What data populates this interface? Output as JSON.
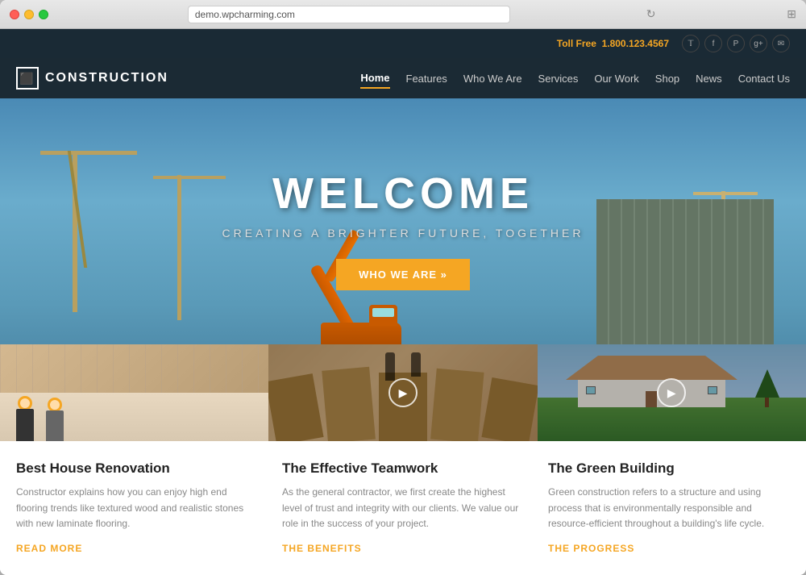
{
  "browser": {
    "url": "demo.wpcharming.com",
    "dots": [
      "red",
      "yellow",
      "green"
    ]
  },
  "top_header": {
    "toll_free_label": "Toll Free",
    "phone": "1.800.123.4567",
    "social_icons": [
      {
        "name": "twitter-icon",
        "symbol": "𝕥"
      },
      {
        "name": "facebook-icon",
        "symbol": "f"
      },
      {
        "name": "pinterest-icon",
        "symbol": "p"
      },
      {
        "name": "google-plus-icon",
        "symbol": "g"
      },
      {
        "name": "email-icon",
        "symbol": "✉"
      }
    ]
  },
  "nav": {
    "logo_text": "CONSTRUCTION",
    "logo_icon": "⬛",
    "links": [
      {
        "label": "Home",
        "active": true
      },
      {
        "label": "Features",
        "active": false
      },
      {
        "label": "Who We Are",
        "active": false
      },
      {
        "label": "Services",
        "active": false
      },
      {
        "label": "Our Work",
        "active": false
      },
      {
        "label": "Shop",
        "active": false
      },
      {
        "label": "News",
        "active": false
      },
      {
        "label": "Contact Us",
        "active": false
      }
    ]
  },
  "hero": {
    "title": "WELCOME",
    "subtitle": "CREATING A BRIGHTER FUTURE, TOGETHER",
    "button_label": "WHO WE ARE »"
  },
  "cards": [
    {
      "title": "Best House Renovation",
      "text": "Constructor explains how you can enjoy high end flooring trends like textured wood and realistic stones with new laminate flooring.",
      "link": "READ MORE",
      "has_play": false
    },
    {
      "title": "The Effective Teamwork",
      "text": "As the general contractor, we first create the highest level of trust and integrity with our clients. We value our role in the success of your project.",
      "link": "THE BENEFITS",
      "has_play": true
    },
    {
      "title": "The Green Building",
      "text": "Green construction refers to a structure and using process that is environmentally responsible and resource-efficient throughout a building's life cycle.",
      "link": "THE PROGRESS",
      "has_play": true
    }
  ]
}
